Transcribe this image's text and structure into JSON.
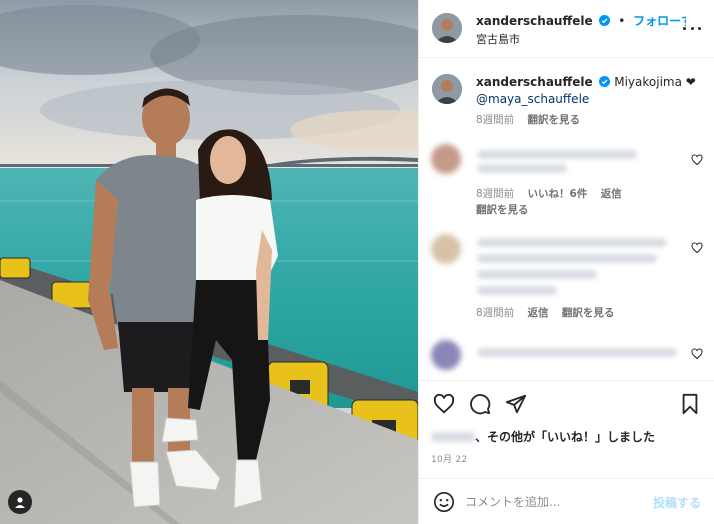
{
  "post": {
    "username": "xanderschauffele",
    "follow_label": "フォローする",
    "location": "宮古島市",
    "caption_text": "Miyakojima ❤",
    "caption_mention": "@maya_schauffele",
    "caption_time": "8週間前",
    "translate_label": "翻訳を見る"
  },
  "comments": [
    {
      "time": "8週間前",
      "likes": "いいね！6件",
      "reply": "返信",
      "translate": "翻訳を見る"
    },
    {
      "time": "8週間前",
      "reply": "返信",
      "translate": "翻訳を見る"
    },
    {}
  ],
  "likes_text": "、その他が「いいね！」しました",
  "date": "10月 22",
  "comment_box": {
    "placeholder": "コメントを追加...",
    "post_label": "投稿する"
  },
  "colors": {
    "accent": "#0095f6",
    "mention": "#00376b",
    "muted": "#8e8e8e",
    "post_disabled": "#b2dffc"
  },
  "icons": [
    "verified-badge-icon",
    "more-options-icon",
    "heart-icon",
    "comment-icon",
    "share-icon",
    "bookmark-icon",
    "emoji-icon",
    "user-tag-icon"
  ]
}
